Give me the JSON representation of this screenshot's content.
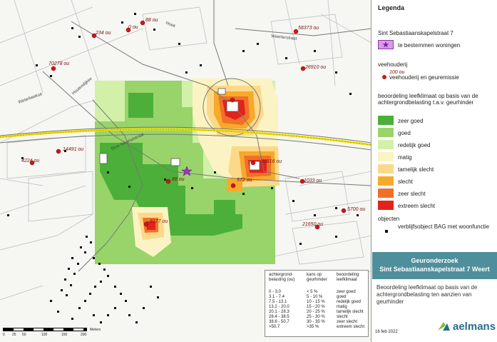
{
  "map": {
    "emission_labels": [
      {
        "id": "e1",
        "text": "234 ou"
      },
      {
        "id": "e2",
        "text": "0 ou"
      },
      {
        "id": "e3",
        "text": "88 ou"
      },
      {
        "id": "e4",
        "text": "58373 ou"
      },
      {
        "id": "e5",
        "text": "70278 ou"
      },
      {
        "id": "e6",
        "text": "26910 ou"
      },
      {
        "id": "e7",
        "text": "14491 ou"
      },
      {
        "id": "e8",
        "text": "4224 ou"
      },
      {
        "id": "e9",
        "text": "88 ou"
      },
      {
        "id": "e10",
        "text": "35816 ou"
      },
      {
        "id": "e11",
        "text": "1033 ou"
      },
      {
        "id": "e12",
        "text": "572 ou"
      },
      {
        "id": "e13",
        "text": "5700 ou"
      },
      {
        "id": "e14",
        "text": "21650 ou"
      },
      {
        "id": "e15",
        "text": "8177 ou"
      }
    ],
    "road_labels": [
      {
        "id": "r1",
        "text": "Hoek"
      },
      {
        "id": "r2",
        "text": "Weerterstraat"
      },
      {
        "id": "r3",
        "text": "Weterbeekse"
      },
      {
        "id": "r4",
        "text": "Houtendijkse"
      },
      {
        "id": "r5",
        "text": "Bree Waarsestraat"
      }
    ],
    "scale": {
      "labels": [
        "0",
        "25",
        "50",
        "100",
        "150",
        "200"
      ],
      "unit": "Meters"
    },
    "table": {
      "headers": [
        "achtergrond-\nbelasting (ou)",
        "kans op\ngeurhinder",
        "beoordeling\nleefklimaat"
      ],
      "rows": [
        [
          "0 - 3.0",
          "< 5 %",
          "zeer goed"
        ],
        [
          "3.1 - 7.4",
          "5 - 10 %",
          "goed"
        ],
        [
          "7.5 - 13.1",
          "10 - 15 %",
          "redelijk goed"
        ],
        [
          "13.2 - 20.0",
          "15 - 20 %",
          "matig"
        ],
        [
          "20.1 - 28.3",
          "20 - 25 %",
          "tamelijk slecht"
        ],
        [
          "28.4 - 38.5",
          "25 - 30 %",
          "slecht"
        ],
        [
          "38.6 - 50.7",
          "30 - 35 %",
          "zeer slecht"
        ],
        [
          ">50.7",
          ">35 %",
          "extreem slecht"
        ]
      ]
    }
  },
  "legend": {
    "title": "Legenda",
    "subject": "Sint Sebastiaanskapelstraat 7",
    "star_label": "te bestemmen woningen",
    "veehouderij_heading": "veehouderij",
    "veehouderij_value": "100 ou",
    "veehouderij_label": "veehouderij en geuremissie",
    "classes_heading": "beoordeling leefklimaat op basis van de achtergrondbelasting t.a.v. geurhinder",
    "classes": [
      {
        "label": "zeer goed",
        "color": "#4caf3a"
      },
      {
        "label": "goed",
        "color": "#98d46a"
      },
      {
        "label": "redelijk goed",
        "color": "#d2f0a8"
      },
      {
        "label": "matig",
        "color": "#fbf3c4"
      },
      {
        "label": "tamelijk slecht",
        "color": "#fcd98a"
      },
      {
        "label": "slecht",
        "color": "#f7a92b"
      },
      {
        "label": "zeer slecht",
        "color": "#f0702a"
      },
      {
        "label": "extreem slecht",
        "color": "#e3231b"
      }
    ],
    "objects_heading": "objecten",
    "objects_label": "verblijfsobject BAG met woonfunctie"
  },
  "title_box": {
    "line1": "Geuronderzoek",
    "line2": "Sint Sebastiaanskapelstraat 7 Weert"
  },
  "description": "Beoordeling leefklimaat op basis van de achtergrondbelasting ten aanzien van geurhinder",
  "date": "16 feb 2022",
  "logo": {
    "text": "aelmans"
  }
}
